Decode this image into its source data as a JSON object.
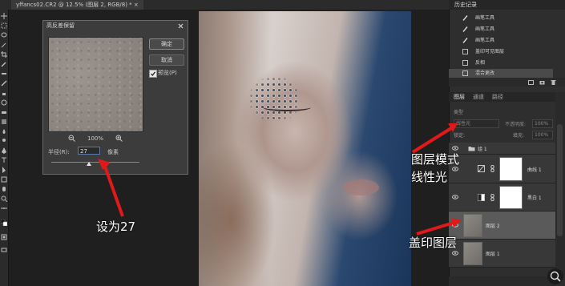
{
  "tab": {
    "title": "yffancs02.CR2 @ 12.5% (图层 2, RGB/8) *",
    "close": "×"
  },
  "dialog": {
    "title": "高反差保留",
    "ok_label": "确定",
    "cancel_label": "取消",
    "preview_label": "预览(P)",
    "preview_checked": true,
    "zoom_level": "100%",
    "radius_label": "半径(R):",
    "radius_value": "27",
    "radius_unit": "像素",
    "slider_fraction": 0.43
  },
  "history": {
    "tab_label": "历史记录",
    "items": [
      {
        "label": "画笔工具",
        "icon": "brush-icon"
      },
      {
        "label": "画笔工具",
        "icon": "brush-icon"
      },
      {
        "label": "画笔工具",
        "icon": "brush-icon"
      },
      {
        "label": "盖印可见图层",
        "icon": "layer-icon"
      },
      {
        "label": "反相",
        "icon": "layer-icon"
      },
      {
        "label": "混合更改",
        "icon": "layer-icon",
        "selected": true
      }
    ]
  },
  "layers": {
    "tabs": [
      "图层",
      "通道",
      "路径"
    ],
    "filter_label": "类型",
    "blend_mode": "线性光",
    "opacity_label": "不透明度:",
    "opacity_value": "100%",
    "lock_label": "锁定:",
    "fill_label": "填充:",
    "fill_value": "100%",
    "items": [
      {
        "name": "组 1",
        "type": "group"
      },
      {
        "name": "曲线 1",
        "type": "curves"
      },
      {
        "name": "黑白 1",
        "type": "bw"
      },
      {
        "name": "图层 2",
        "type": "pixel",
        "selected": true
      },
      {
        "name": "图层 1",
        "type": "pixel"
      }
    ]
  },
  "annotations": {
    "set_to": "设为27",
    "blend_title": "图层模式",
    "blend_mode": "线性光",
    "stamp_layer": "盖印图层"
  },
  "colors": {
    "annotation_arrow": "#e0191a",
    "selected_layer": "#5a5a5a"
  }
}
